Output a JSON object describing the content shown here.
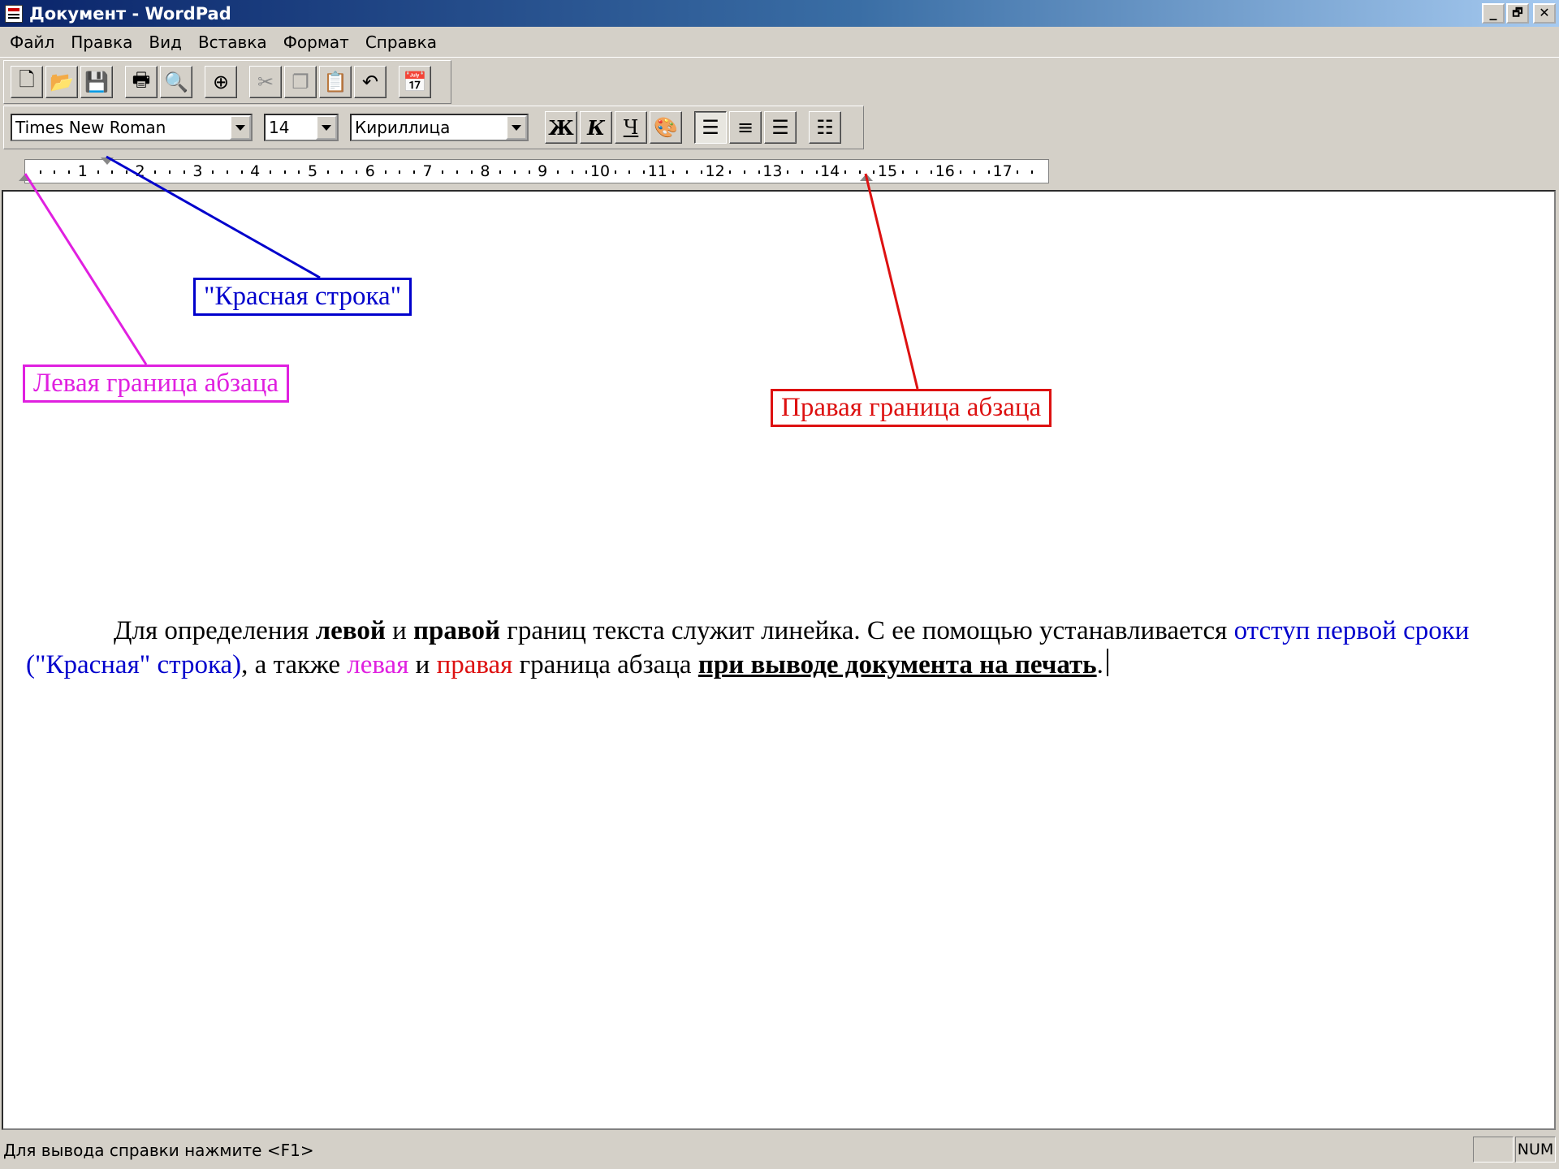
{
  "window": {
    "title": "Документ - WordPad",
    "minimize": "_",
    "restore": "🗗",
    "close": "✕"
  },
  "menu": [
    "Файл",
    "Правка",
    "Вид",
    "Вставка",
    "Формат",
    "Справка"
  ],
  "toolbar": {
    "standard_icons": [
      "new-document-icon",
      "open-folder-icon",
      "save-icon",
      "print-icon",
      "print-preview-icon",
      "find-icon",
      "cut-icon",
      "copy-icon",
      "paste-icon",
      "undo-icon",
      "insert-date-icon"
    ],
    "font_name": "Times New Roman",
    "font_size": "14",
    "script": "Кириллица",
    "bold_label": "Ж",
    "italic_label": "К",
    "underline_label": "Ч",
    "format_icons": [
      "color-palette-icon",
      "align-left-icon",
      "align-center-icon",
      "align-right-icon",
      "bullets-icon"
    ]
  },
  "ruler": {
    "numbers": [
      "1",
      "2",
      "3",
      "4",
      "5",
      "6",
      "7",
      "8",
      "9",
      "10",
      "11",
      "12",
      "13",
      "14",
      "15",
      "16",
      "17"
    ]
  },
  "callouts": {
    "first_line": "\"Красная строка\"",
    "left_indent": "Левая граница абзаца",
    "right_indent": "Правая граница абзаца"
  },
  "colors": {
    "first_line": "#0000cc",
    "left_indent": "#e020e0",
    "right_indent": "#dd1111"
  },
  "document": {
    "s1": "Для определения ",
    "b1": "левой",
    "s2": " и ",
    "b2": "правой",
    "s3": " границ текста служит линейка. С ее помощью устанавливается ",
    "blue": "отступ первой сроки (\"Красная\" строка)",
    "s4": ", а также ",
    "pink": "левая",
    "s5": " и ",
    "red": "правая",
    "s6": " граница абзаца ",
    "bu": "при выводе документа на печать",
    "s7": "."
  },
  "status": {
    "help": "Для вывода справки нажмите <F1>",
    "num": "NUM"
  }
}
